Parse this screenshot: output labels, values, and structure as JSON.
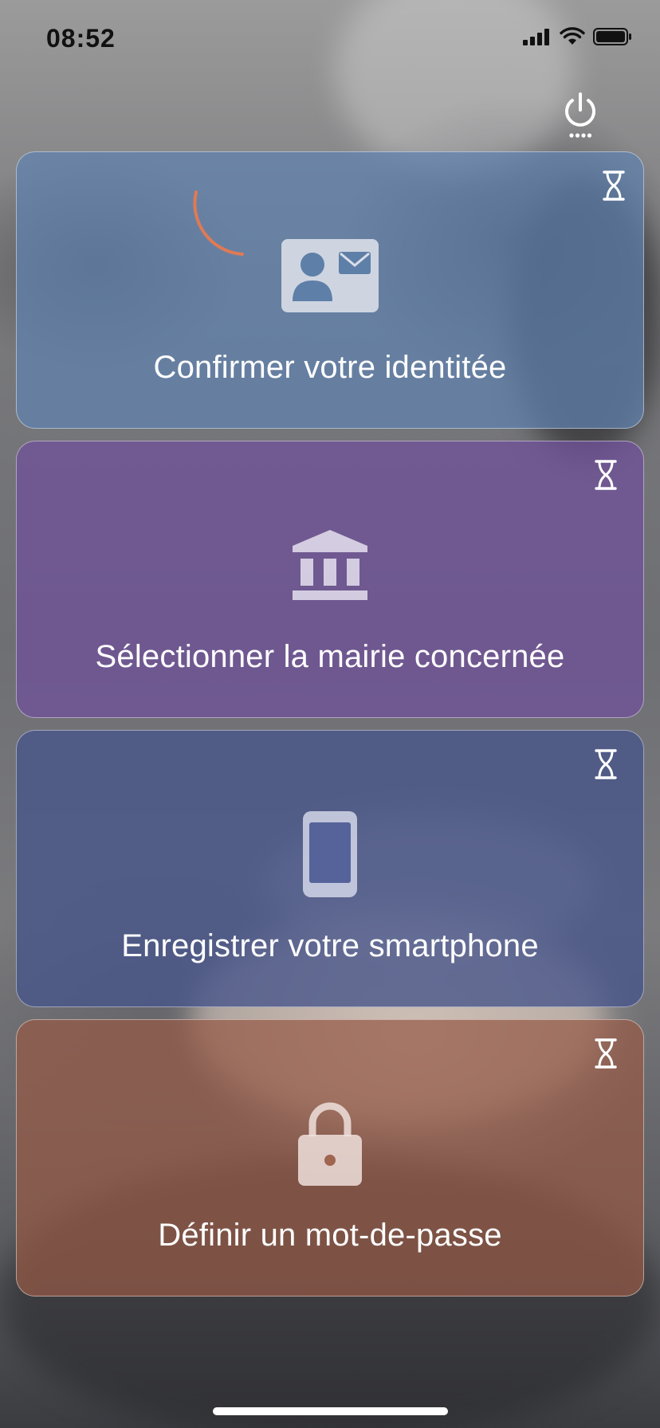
{
  "status_bar": {
    "time": "08:52",
    "icons": [
      "cellular-signal-icon",
      "wifi-icon",
      "battery-icon"
    ]
  },
  "header": {
    "power_icon": "power-icon"
  },
  "steps": [
    {
      "label": "Confirmer votre identitée",
      "icon": "id-card-icon",
      "status_icon": "hourglass-icon",
      "color": "#6082b0"
    },
    {
      "label": "Sélectionner la mairie concernée",
      "icon": "city-hall-icon",
      "status_icon": "hourglass-icon",
      "color": "#705298"
    },
    {
      "label": "Enregistrer votre smartphone",
      "icon": "smartphone-icon",
      "status_icon": "hourglass-icon",
      "color": "#46548a"
    },
    {
      "label": "Définir un mot-de-passe",
      "icon": "lock-icon",
      "status_icon": "hourglass-icon",
      "color": "#965a46"
    }
  ],
  "accent_color": "#e07a55"
}
